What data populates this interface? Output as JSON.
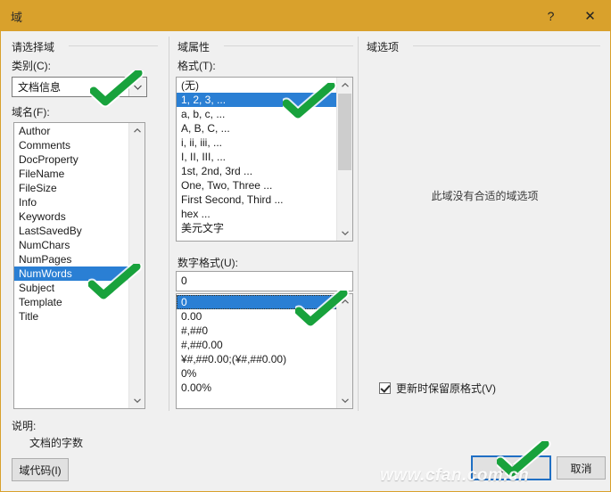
{
  "window": {
    "title": "域",
    "help_icon": "?",
    "close_icon": "✕",
    "titlebar_color": "#d9a12c",
    "accent_color": "#2a7fd4",
    "annotation_color": "#18a23c"
  },
  "groups": {
    "select_field": "请选择域",
    "field_properties": "域属性",
    "field_options": "域选项"
  },
  "category": {
    "label": "类别(C):",
    "value": "文档信息"
  },
  "field_names": {
    "label": "域名(F):",
    "items": [
      "Author",
      "Comments",
      "DocProperty",
      "FileName",
      "FileSize",
      "Info",
      "Keywords",
      "LastSavedBy",
      "NumChars",
      "NumPages",
      "NumWords",
      "Subject",
      "Template",
      "Title"
    ],
    "selected": "NumWords",
    "selected_index": 10
  },
  "format": {
    "label": "格式(T):",
    "items": [
      "(无)",
      "1, 2, 3, ...",
      "a, b, c, ...",
      "A, B, C, ...",
      "i, ii, iii, ...",
      "I, II, III, ...",
      "1st, 2nd, 3rd ...",
      "One, Two, Three ...",
      "First Second, Third ...",
      "hex ...",
      "美元文字"
    ],
    "selected": "1, 2, 3, ...",
    "selected_index": 1
  },
  "number_format": {
    "label": "数字格式(U):",
    "value": "0",
    "items": [
      "0",
      "0.00",
      "#,##0",
      "#,##0.00",
      "¥#,##0.00;(¥#,##0.00)",
      "0%",
      "0.00%"
    ],
    "selected": "0",
    "selected_index": 0
  },
  "field_options_panel": {
    "empty_message": "此域没有合适的域选项"
  },
  "preserve_formatting": {
    "label": "更新时保留原格式(V)",
    "checked": true
  },
  "description": {
    "label": "说明:",
    "text": "文档的字数"
  },
  "buttons": {
    "field_codes": "域代码(I)",
    "ok": "确定",
    "cancel": "取消"
  },
  "watermark": "www.cfan.com.cn"
}
